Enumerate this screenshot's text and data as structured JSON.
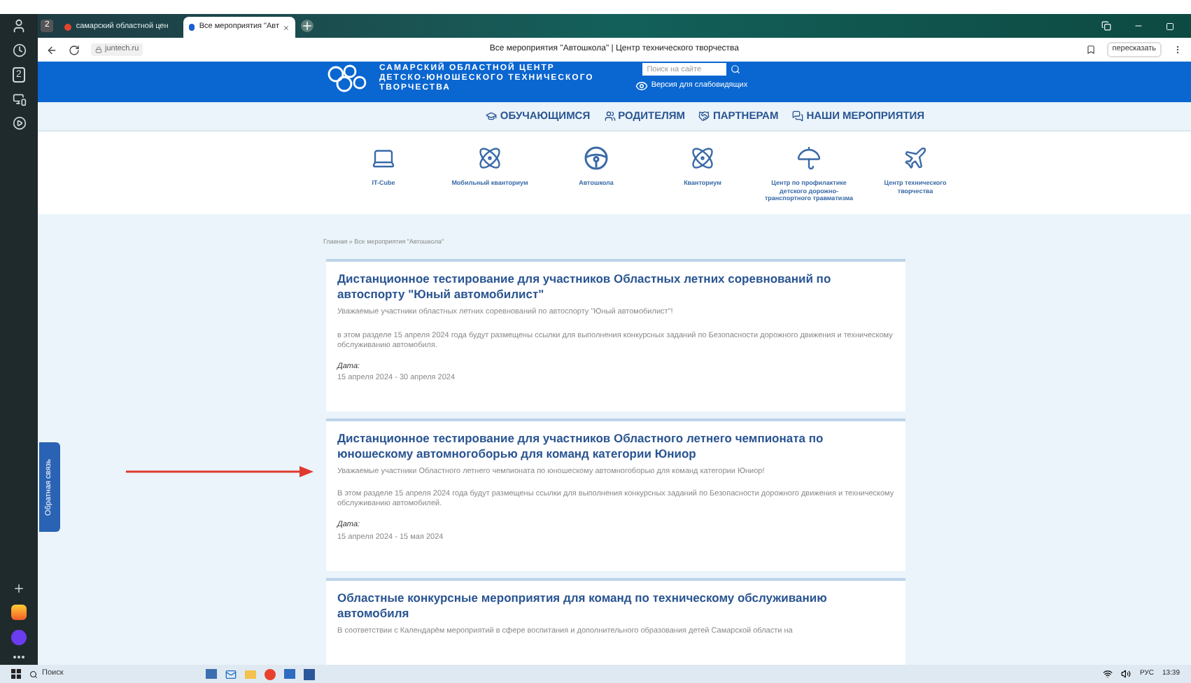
{
  "browser": {
    "tabs": [
      {
        "title": "самарский областной цен",
        "selected": false
      },
      {
        "title": "Все мероприятия \"Авт",
        "selected": true
      }
    ],
    "tab_counter": "2",
    "sidebar_counter": "2",
    "url": "juntech.ru",
    "page_title": "Все мероприятия \"Автошкола\" | Центр технического творчества",
    "summarize_button": "пересказать"
  },
  "site": {
    "logo_lines": [
      "САМАРСКИЙ ОБЛАСТНОЙ ЦЕНТР",
      "ДЕТСКО-ЮНОШЕСКОГО ТЕХНИЧЕСКОГО",
      "ТВОРЧЕСТВА"
    ],
    "search": {
      "placeholder": "Поиск на сайте"
    },
    "low_vision_link": "Версия для слабовидящих",
    "nav": [
      {
        "kind": "student",
        "label": "ОБУЧАЮЩИМСЯ"
      },
      {
        "kind": "parents",
        "label": "РОДИТЕЛЯМ"
      },
      {
        "kind": "partners",
        "label": "ПАРТНЕРАМ"
      },
      {
        "kind": "events",
        "label": "НАШИ МЕРОПРИЯТИЯ"
      }
    ],
    "sections": [
      {
        "kind": "laptop",
        "label": "IT-Cube"
      },
      {
        "kind": "atom",
        "label": "Мобильный кванториум"
      },
      {
        "kind": "wheel",
        "label": "Автошкола"
      },
      {
        "kind": "atom",
        "label": "Кванториум"
      },
      {
        "kind": "umbrella",
        "label": "Центр по профилактике детского дорожно-транспортного травматизма"
      },
      {
        "kind": "plane",
        "label": "Центр технического творчества"
      }
    ],
    "breadcrumb": "Главная » Все мероприятия \"Автошкола\"",
    "events": [
      {
        "title": "Дистанционное тестирование для участников Областных летних соревнований по автоспорту \"Юный автомобилист\"",
        "intro": "Уважаемые участники областных летних соревнований по автоспорту \"Юный автомобилист\"!",
        "body": "в этом разделе 15 апреля 2024 года будут размещены ссылки для выполнения конкурсных заданий по Безопасности дорожного движения и техническому обслуживанию автомобиля.",
        "date_label": "Дата:",
        "date": "15 апреля 2024 - 30 апреля 2024"
      },
      {
        "title": "Дистанционное тестирование для участников Областного летнего чемпионата по юношескому автомногоборью для команд категории Юниор",
        "intro": "Уважаемые участники Областного летнего чемпионата по юношескому автомногоборью для команд категории Юниор!",
        "body": "В этом разделе 15 апреля 2024 года будут размещены ссылки для выполнения конкурсных заданий по Безопасности дорожного движения и техническому обслуживанию автомобилей.",
        "date_label": "Дата:",
        "date": "15 апреля 2024 - 15 мая 2024"
      },
      {
        "title": "Областные конкурсные мероприятия для команд по техническому обслуживанию автомобиля",
        "intro": "В соответствии с Календарём мероприятий в сфере воспитания и дополнительного образования детей Самарской области на"
      }
    ],
    "feedback_tab": "Обратная связь"
  },
  "taskbar": {
    "search": {
      "placeholder": "Поиск"
    },
    "language": "РУС",
    "time": "13:39"
  }
}
